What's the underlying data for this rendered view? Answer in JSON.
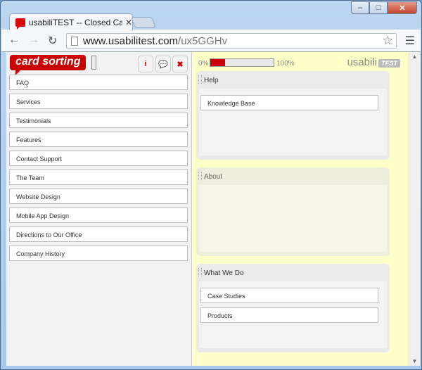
{
  "browser": {
    "tab_title": "usabiliTEST -- Closed Card Sorting",
    "url_host": "www.usabilitest.com",
    "url_path": "/ux5GGHv"
  },
  "app": {
    "logo": "card sorting",
    "brand": "usabili",
    "brand_badge": "TEST",
    "progress": {
      "start_label": "0%",
      "end_label": "100%",
      "percent": 23,
      "fill_color": "#cc0000"
    },
    "unsorted_cards": [
      "FAQ",
      "Services",
      "Testimonials",
      "Features",
      "Contact Support",
      "The Team",
      "Website Design",
      "Mobile App Design",
      "Directions to Our Office",
      "Company History"
    ],
    "categories": [
      {
        "name": "Help",
        "cards": [
          "Knowledge Base"
        ]
      },
      {
        "name": "About",
        "cards": []
      },
      {
        "name": "What We Do",
        "cards": [
          "Case Studies",
          "Products"
        ]
      }
    ]
  }
}
